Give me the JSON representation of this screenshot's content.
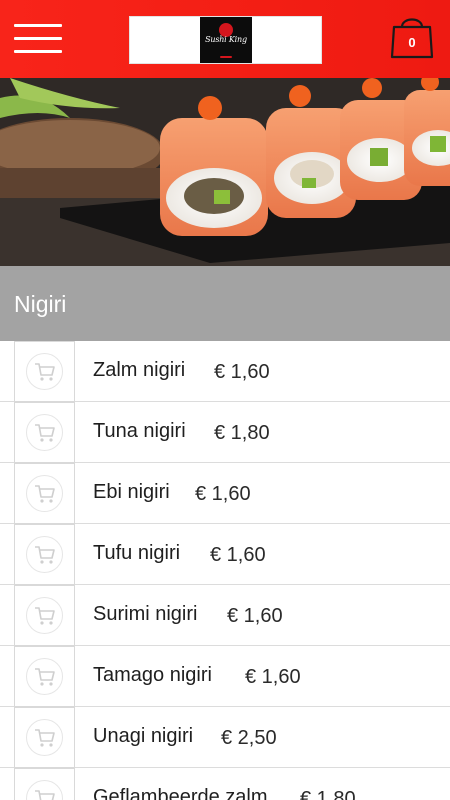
{
  "header": {
    "brand_logo_text": "Sushi King",
    "cart_count": "0",
    "colors": {
      "brand_red": "#f31e14",
      "logo_red": "#d4161d"
    }
  },
  "category": {
    "title": "Nigiri"
  },
  "items": [
    {
      "name": "Zalm nigiri",
      "price": "€ 1,60"
    },
    {
      "name": "Tuna nigiri",
      "price": "€ 1,80"
    },
    {
      "name": "Ebi nigiri",
      "price": "€ 1,60"
    },
    {
      "name": "Tufu nigiri",
      "price": "€ 1,60"
    },
    {
      "name": "Surimi nigiri",
      "price": "€ 1,60"
    },
    {
      "name": "Tamago nigiri",
      "price": "€ 1,60"
    },
    {
      "name": "Unagi nigiri",
      "price": "€ 2,50"
    },
    {
      "name": "Geflambeerde zalm",
      "price": "€ 1,80"
    }
  ],
  "icons": {
    "menu": "hamburger-menu-icon",
    "cart": "shopping-bag-icon",
    "add": "shopping-cart-icon"
  }
}
